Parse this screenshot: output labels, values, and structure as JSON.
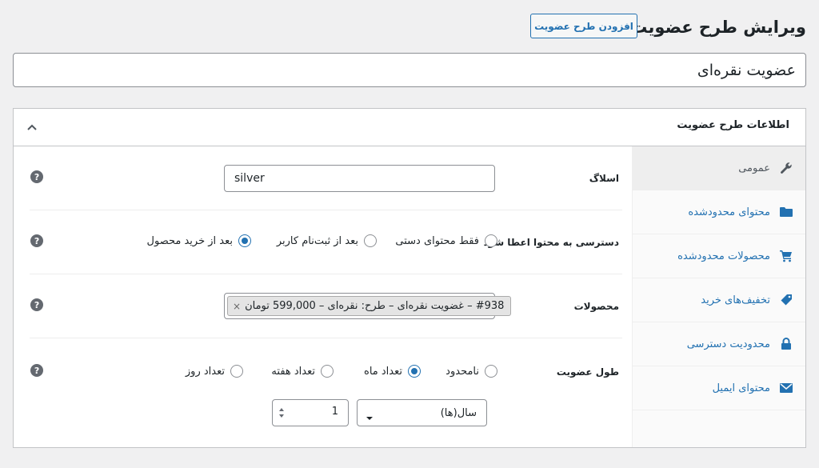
{
  "header": {
    "title": "ویرایش طرح عضویت",
    "add_new_label": "افزودن طرح عضویت"
  },
  "post_title": {
    "value": "عضویت نقره‌ای"
  },
  "metabox": {
    "title": "اطلاعات طرح عضویت"
  },
  "tabs": [
    {
      "label": "عمومی",
      "icon": "wrench-icon",
      "active": true
    },
    {
      "label": "محتوای محدودشده",
      "icon": "folder-icon",
      "active": false
    },
    {
      "label": "محصولات محدودشده",
      "icon": "cart-icon",
      "active": false
    },
    {
      "label": "تخفیف‌های خرید",
      "icon": "tag-icon",
      "active": false
    },
    {
      "label": "محدودیت دسترسی",
      "icon": "lock-icon",
      "active": false
    },
    {
      "label": "محتوای ایمیل",
      "icon": "email-icon",
      "active": false
    }
  ],
  "fields": {
    "slug": {
      "label": "اسلاگ",
      "value": "silver"
    },
    "access": {
      "label": "دسترسی به محتوا اعطا شود",
      "options": [
        "فقط محتوای دستی",
        "بعد از ثبت‌نام کاربر",
        "بعد از خرید محصول"
      ],
      "selected": "بعد از خرید محصول"
    },
    "products": {
      "label": "محصولات",
      "chips": [
        "#938 – غضویت نقره‌ای – طرح: نقره‌ای – 599,000 تومان"
      ],
      "remove_glyph": "×"
    },
    "length": {
      "label": "طول عضویت",
      "options": [
        "نامحدود",
        "تعداد ماه",
        "تعداد هفته",
        "تعداد روز"
      ],
      "selected": "تعداد ماه",
      "period_select": "سال(ها)",
      "amount": "1"
    },
    "help_glyph": "?"
  },
  "colors": {
    "accent": "#2271b1",
    "background": "#f0f0f1",
    "border": "#c3c4c7"
  }
}
